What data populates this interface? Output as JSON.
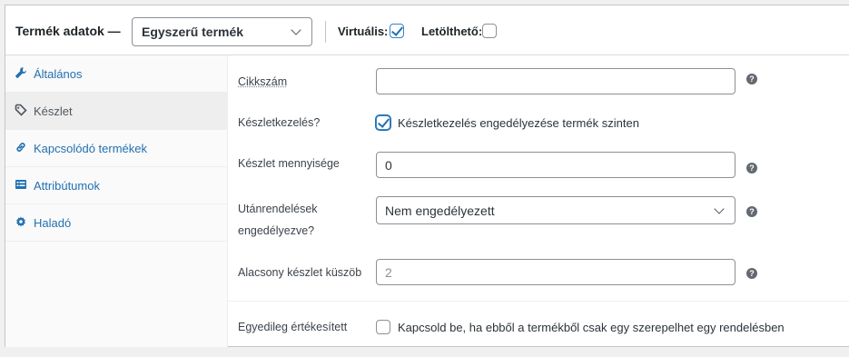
{
  "header": {
    "title": "Termék adatok —",
    "product_type": "Egyszerű termék",
    "virtual_label": "Virtuális:",
    "virtual_checked": true,
    "downloadable_label": "Letölthető:",
    "downloadable_checked": false
  },
  "sidebar": {
    "items": [
      {
        "label": "Általános",
        "icon": "wrench-icon",
        "active": false
      },
      {
        "label": "Készlet",
        "icon": "tag-icon",
        "active": true
      },
      {
        "label": "Kapcsolódó termékek",
        "icon": "link-icon",
        "active": false
      },
      {
        "label": "Attribútumok",
        "icon": "list-icon",
        "active": false
      },
      {
        "label": "Haladó",
        "icon": "gear-icon",
        "active": false
      }
    ]
  },
  "inventory": {
    "sku_label": "Cikkszám",
    "sku_value": "",
    "manage_stock_label": "Készletkezelés?",
    "manage_stock_text": "Készletkezelés engedélyezése termék szinten",
    "manage_stock_checked": true,
    "stock_qty_label": "Készlet mennyisége",
    "stock_qty_value": "0",
    "backorders_label_1": "Utánrendelések",
    "backorders_label_2": "engedélyezve?",
    "backorders_value": "Nem engedélyezett",
    "low_stock_label": "Alacsony készlet küszöb",
    "low_stock_placeholder": "2",
    "sold_individually_label": "Egyedileg értékesített",
    "sold_individually_text": "Kapcsold be, ha ebből a termékből csak egy szerepelhet egy rendelésben",
    "sold_individually_checked": false,
    "help_glyph": "?"
  },
  "colors": {
    "accent": "#2271b1",
    "border": "#8c8f94",
    "text": "#1d2327"
  }
}
